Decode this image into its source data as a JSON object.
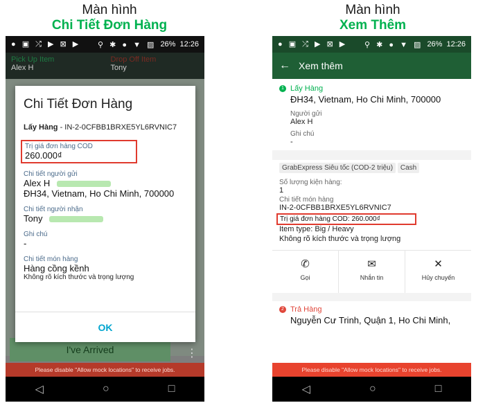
{
  "captions": {
    "left": {
      "line1": "Màn hình",
      "line2": "Chi Tiết Đơn Hàng"
    },
    "right": {
      "line1": "Màn hình",
      "line2": "Xem Thêm"
    }
  },
  "statusbar": {
    "left_icons": "● ▣ ⤮ ▶ ⊠ ▶",
    "right_icons": "⚲ ✱ ● ▼ ▨",
    "battery": "26%",
    "time": "12:26"
  },
  "navbar": {
    "back": "◁",
    "home": "○",
    "recents": "□"
  },
  "warning": "Please disable \"Allow mock locations\" to receive jobs.",
  "left": {
    "tabs": [
      {
        "title": "Pick Up Item",
        "name": "Alex H"
      },
      {
        "title": "Drop Off Item",
        "name": "Tony"
      }
    ],
    "dialog": {
      "title": "Chi Tiết Đơn Hàng",
      "order_label": "Lấy Hàng",
      "order_id": " - IN-2-0CFBB1BRXE5YL6RVNIC7",
      "cod_label": "Trị giá đơn hàng COD",
      "cod_value": "260.000₫",
      "sender_label": "Chi tiết người gửi",
      "sender_name": "Alex H",
      "sender_address": "ĐH34, Vietnam, Ho Chi Minh, 700000",
      "receiver_label": "Chi tiết người nhận",
      "receiver_name": "Tony",
      "note_label": "Ghi chú",
      "note_value": "-",
      "item_label": "Chi tiết món hàng",
      "item_value": "Hàng cồng kềnh",
      "item_sub": "Không rõ kích thước và trọng lượng",
      "ok": "OK"
    },
    "arrived_button": "I've Arrived",
    "more_icon": "⋮"
  },
  "right": {
    "header": {
      "back_icon": "←",
      "title": "Xem thêm"
    },
    "pickup": {
      "step_number": "1",
      "step_label": "Lấy Hàng",
      "address": "ĐH34, Vietnam, Ho Chi Minh, 700000",
      "sender_label": "Người gửi",
      "sender_value": "Alex H",
      "note_label": "Ghi chú",
      "note_value": "-"
    },
    "service": "GrabExpress Siêu tốc (COD-2 triệu)",
    "payment": "Cash",
    "package_count_label": "Số lượng kiện hàng:",
    "package_count": "1",
    "item_details_label": "Chi tiết món hàng",
    "item_id": "IN-2-0CFBB1BRXE5YL6RVNIC7",
    "cod_text": "Trị giá đơn hàng COD: 260.000₫",
    "item_type": "Item type: Big / Heavy",
    "item_size": "Không rõ kích thước và trọng lượng",
    "actions": [
      {
        "icon": "✆",
        "label": "Gọi"
      },
      {
        "icon": "✉",
        "label": "Nhắn tin"
      },
      {
        "icon": "✕",
        "label": "Hủy chuyến"
      }
    ],
    "dropoff": {
      "step_number": "2",
      "step_label": "Trả Hàng",
      "address": "Nguyễn Cư Trinh, Quận 1, Ho Chi Minh,"
    }
  }
}
